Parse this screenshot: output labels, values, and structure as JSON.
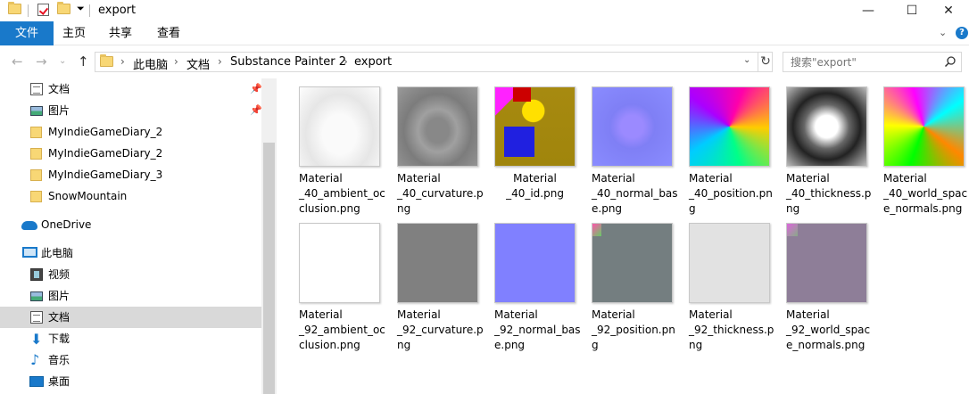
{
  "window": {
    "title": "export",
    "minimize": "—",
    "maximize": "☐",
    "close": "✕"
  },
  "ribbon": {
    "tabs": [
      "文件",
      "主页",
      "共享",
      "查看"
    ],
    "collapse": "⌄",
    "help": "?"
  },
  "nav": {
    "back": "←",
    "forward": "→",
    "recent": "⌄",
    "up": "↑"
  },
  "address": {
    "crumbs": [
      "此电脑",
      "文档",
      "Substance Painter 2",
      "export"
    ],
    "separator": "›",
    "dropdown": "⌄",
    "refresh": "↻"
  },
  "search": {
    "placeholder": "搜索\"export\""
  },
  "sidebar": {
    "pin": "📌",
    "items": [
      {
        "label": "文档",
        "icon": "document-icon",
        "pinned": true
      },
      {
        "label": "图片",
        "icon": "pictures-icon",
        "pinned": true
      },
      {
        "label": "MyIndieGameDiary_2",
        "icon": "folder-icon"
      },
      {
        "label": "MyIndieGameDiary_2",
        "icon": "folder-icon"
      },
      {
        "label": "MyIndieGameDiary_3",
        "icon": "folder-icon"
      },
      {
        "label": "SnowMountain",
        "icon": "folder-icon"
      },
      {
        "label": "OneDrive",
        "icon": "onedrive-icon"
      },
      {
        "label": "此电脑",
        "icon": "this-pc-icon"
      },
      {
        "label": "视频",
        "icon": "videos-icon"
      },
      {
        "label": "图片",
        "icon": "pictures-icon"
      },
      {
        "label": "文档",
        "icon": "document-icon",
        "selected": true
      },
      {
        "label": "下载",
        "icon": "downloads-icon"
      },
      {
        "label": "音乐",
        "icon": "music-icon"
      },
      {
        "label": "桌面",
        "icon": "desktop-icon"
      }
    ]
  },
  "files": [
    {
      "name": "Material_40_ambient_occlusion.png",
      "lines": [
        "Material",
        "_40_ambient_oc",
        "clusion.png"
      ]
    },
    {
      "name": "Material_40_curvature.png",
      "lines": [
        "Material",
        "_40_curvature.p",
        "ng"
      ]
    },
    {
      "name": "Material_40_id.png",
      "lines": [
        "Material",
        "_40_id.png"
      ]
    },
    {
      "name": "Material_40_normal_base.png",
      "lines": [
        "Material",
        "_40_normal_bas",
        "e.png"
      ]
    },
    {
      "name": "Material_40_position.png",
      "lines": [
        "Material",
        "_40_position.pn",
        "g"
      ]
    },
    {
      "name": "Material_40_thickness.png",
      "lines": [
        "Material",
        "_40_thickness.p",
        "ng"
      ]
    },
    {
      "name": "Material_40_world_space_normals.png",
      "lines": [
        "Material",
        "_40_world_spac",
        "e_normals.png"
      ]
    },
    {
      "name": "Material_92_ambient_occlusion.png",
      "lines": [
        "Material",
        "_92_ambient_oc",
        "clusion.png"
      ]
    },
    {
      "name": "Material_92_curvature.png",
      "lines": [
        "Material",
        "_92_curvature.p",
        "ng"
      ]
    },
    {
      "name": "Material_92_normal_base.png",
      "lines": [
        "Material",
        "_92_normal_bas",
        "e.png"
      ]
    },
    {
      "name": "Material_92_position.png",
      "lines": [
        "Material",
        "_92_position.pn",
        "g"
      ]
    },
    {
      "name": "Material_92_thickness.png",
      "lines": [
        "Material",
        "_92_thickness.p",
        "ng"
      ]
    },
    {
      "name": "Material_92_world_space_normals.png",
      "lines": [
        "Material",
        "_92_world_spac",
        "e_normals.png"
      ]
    }
  ]
}
